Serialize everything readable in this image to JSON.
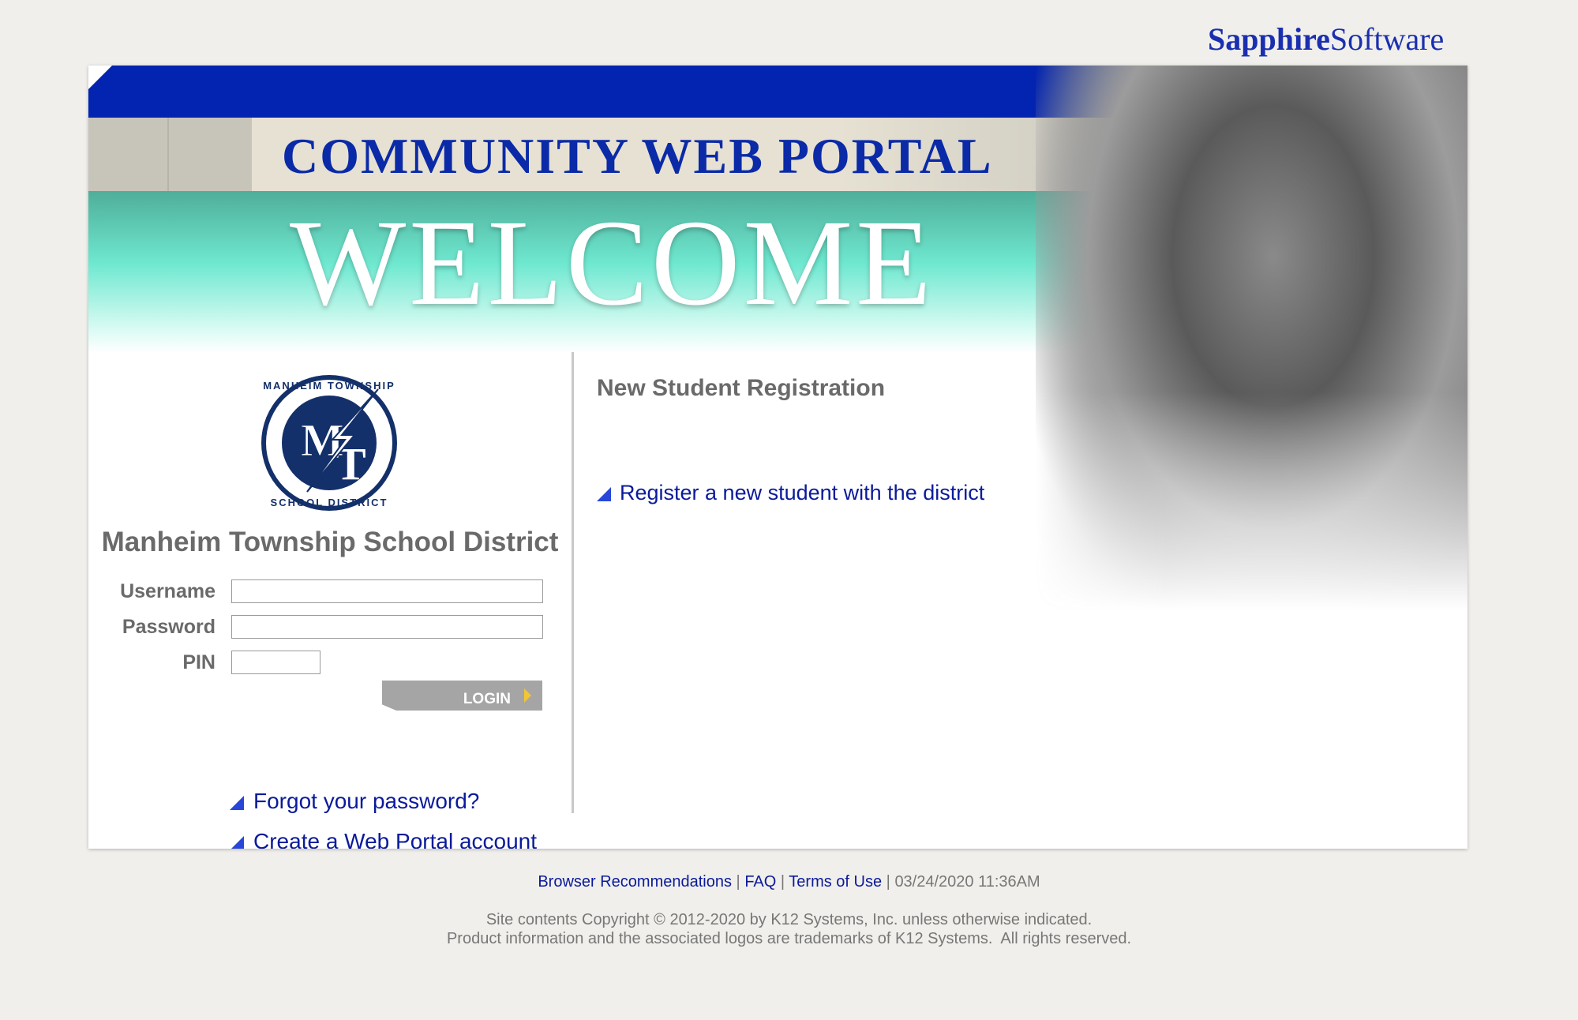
{
  "brand": {
    "bold": "Sapphire",
    "regular": "Software"
  },
  "banner": {
    "title": "COMMUNITY WEB PORTAL",
    "welcome": "WELCOME"
  },
  "login": {
    "district_name": "Manheim Township School District",
    "logo_text": {
      "monogram": "MT",
      "ring": "MANHEIM TOWNSHIP SCHOOL DISTRICT"
    },
    "username_label": "Username",
    "password_label": "Password",
    "pin_label": "PIN",
    "username_value": "",
    "password_value": "",
    "pin_value": "",
    "login_button": "LOGIN",
    "forgot_link": "Forgot your password?",
    "create_link": "Create a Web Portal account"
  },
  "registration": {
    "heading": "New Student Registration",
    "register_link": "Register a new student with the district"
  },
  "footer": {
    "links": [
      "Browser Recommendations",
      "FAQ",
      "Terms of Use"
    ],
    "separator": "|",
    "timestamp": "03/24/2020 11:36AM",
    "copyright_line1": "Site contents Copyright © 2012-2020 by K12 Systems, Inc. unless otherwise indicated.",
    "copyright_line2": "Product information and the associated logos are trademarks of K12 Systems.  All rights reserved."
  },
  "colors": {
    "brand_blue": "#0324b0",
    "link": "#0a1a9a",
    "teal": "#6fe8d0",
    "background": "#f0efeb"
  }
}
